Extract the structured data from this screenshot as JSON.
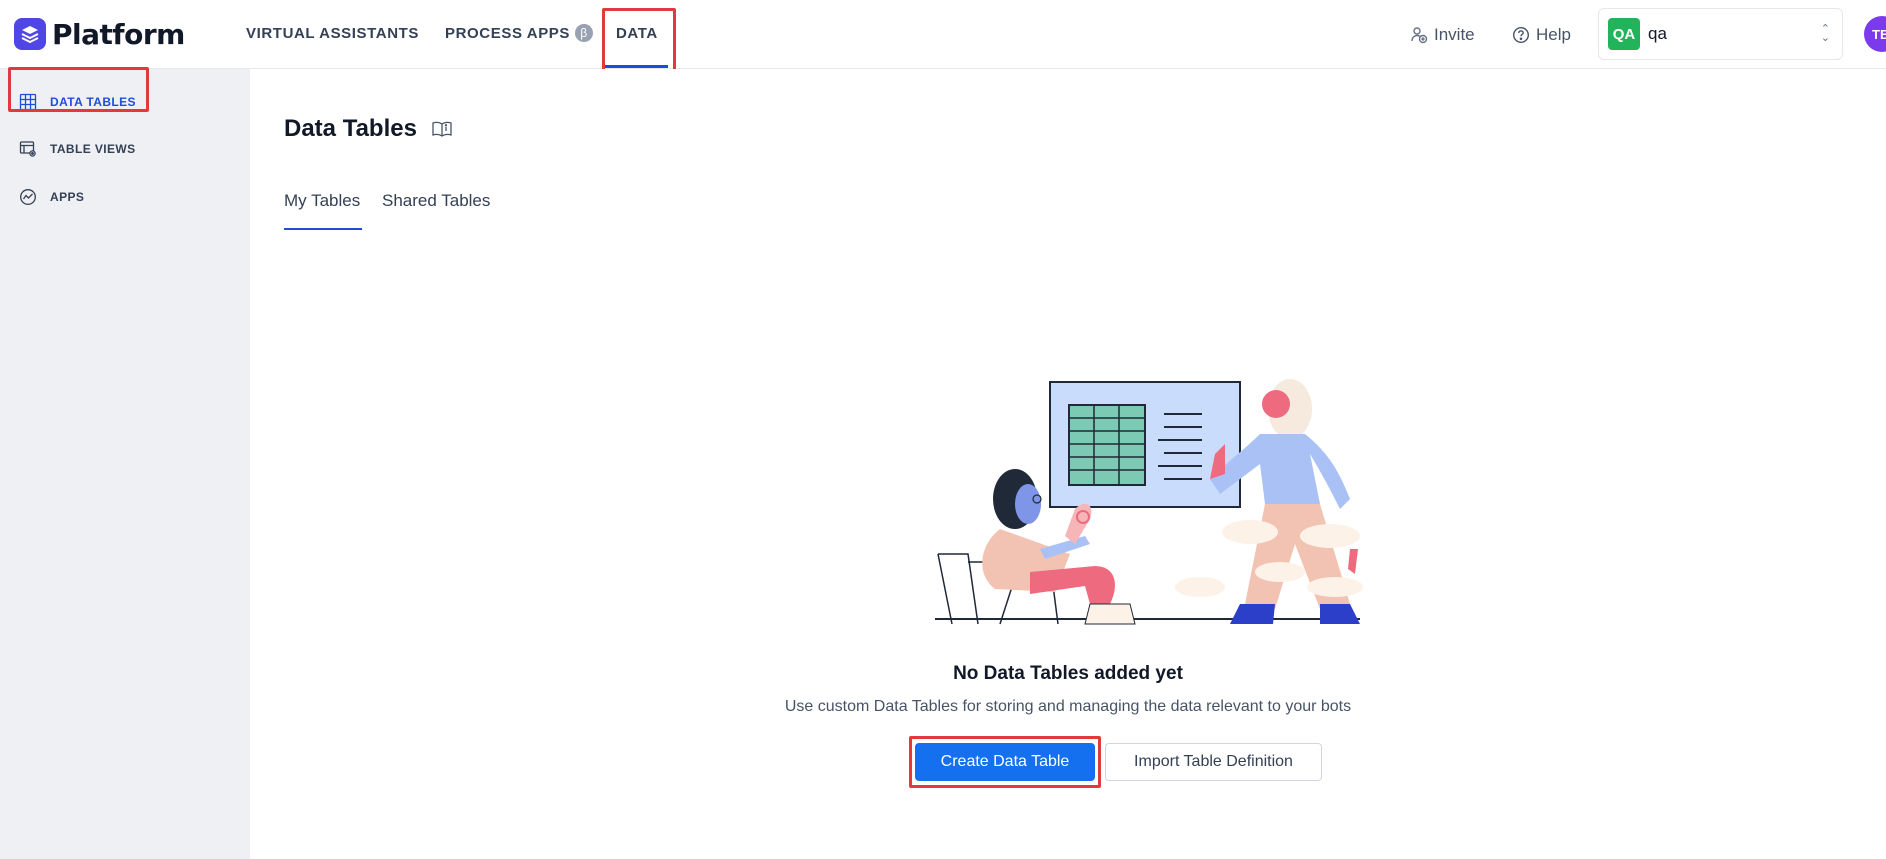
{
  "brand": {
    "name": "Platform",
    "accent": "#4f46e5"
  },
  "topnav": {
    "items": [
      {
        "label": "VIRTUAL ASSISTANTS"
      },
      {
        "label": "PROCESS APPS",
        "badge": "β"
      },
      {
        "label": "DATA",
        "active": true
      }
    ]
  },
  "header": {
    "invite_label": "Invite",
    "help_label": "Help",
    "workspace": {
      "initials": "QA",
      "name": "qa",
      "color": "#22b45a"
    },
    "user_initials": "TE"
  },
  "sidebar": {
    "items": [
      {
        "label": "DATA TABLES",
        "icon": "table-grid-icon",
        "active": true
      },
      {
        "label": "TABLE VIEWS",
        "icon": "table-settings-icon"
      },
      {
        "label": "APPS",
        "icon": "apps-gauge-icon"
      }
    ]
  },
  "main": {
    "title": "Data Tables",
    "tabs": [
      {
        "label": "My Tables",
        "active": true
      },
      {
        "label": "Shared Tables"
      }
    ],
    "empty_state": {
      "title": "No Data Tables added yet",
      "description": "Use custom Data Tables for storing and managing the data relevant to your bots",
      "primary_button": "Create Data Table",
      "secondary_button": "Import Table Definition"
    }
  },
  "colors": {
    "primary": "#1570ef",
    "active_nav": "#1d4ed8",
    "highlight": "#e0393e"
  }
}
